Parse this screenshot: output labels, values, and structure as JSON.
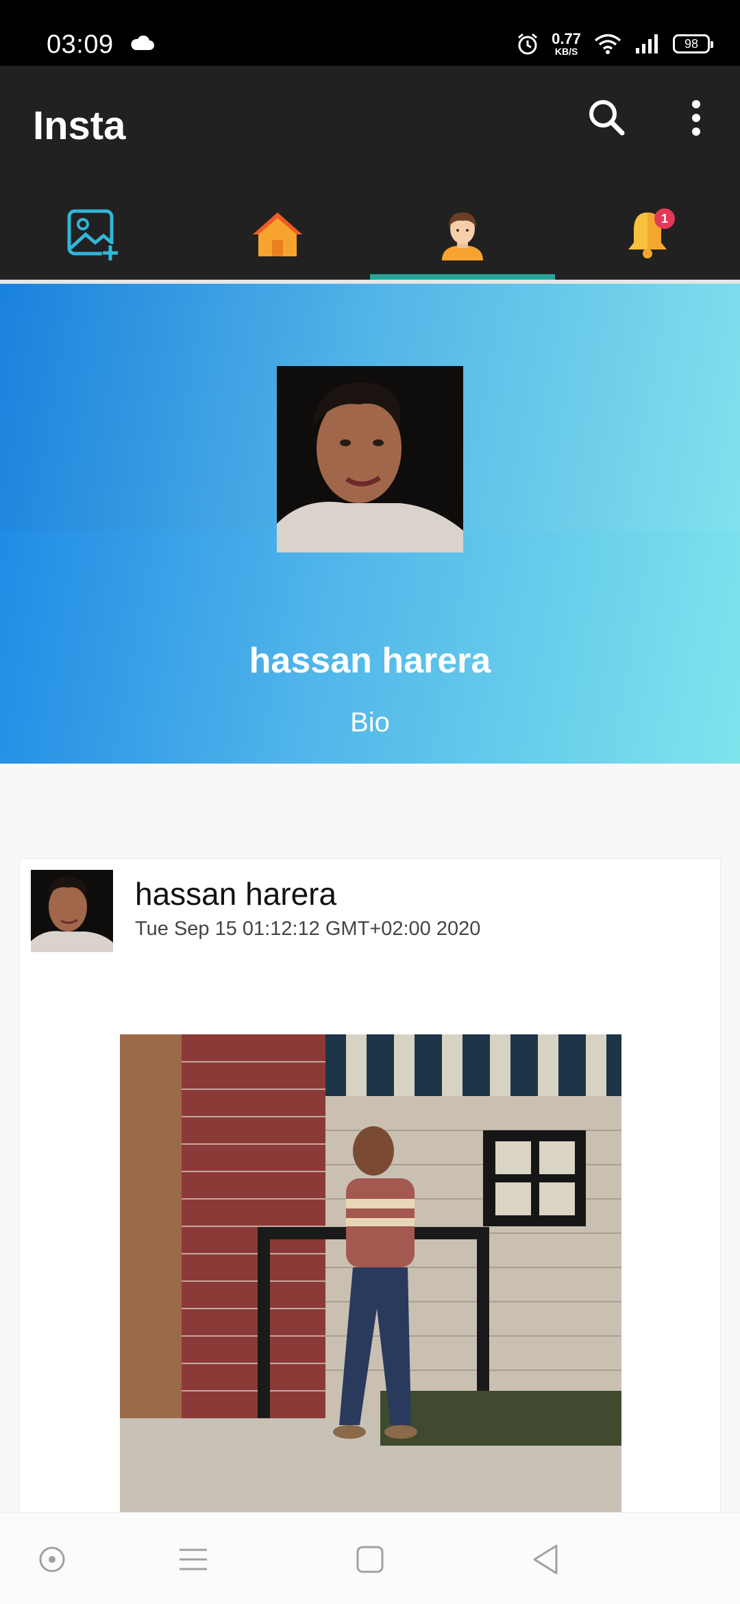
{
  "status_bar": {
    "time": "03:09",
    "speed_value": "0.77",
    "speed_unit": "KB/S",
    "battery": "98",
    "icons": [
      "cloud-icon",
      "alarm-icon",
      "wifi-icon",
      "signal-icon",
      "battery-icon"
    ]
  },
  "app_bar": {
    "title": "Insta",
    "actions": [
      "search-icon",
      "more-vert-icon"
    ]
  },
  "tabs": [
    {
      "icon": "add-image-icon"
    },
    {
      "icon": "home-icon"
    },
    {
      "icon": "profile-icon",
      "selected": true
    },
    {
      "icon": "bell-icon",
      "badge": "1"
    }
  ],
  "profile": {
    "name": "hassan harera",
    "bio": "Bio"
  },
  "post": {
    "author": "hassan harera",
    "date": "Tue Sep 15 01:12:12 GMT+02:00 2020"
  },
  "colors": {
    "app_bar": "#212121",
    "tab_indicator": "#26a69a",
    "gradient_start": "#1a86e4",
    "gradient_end": "#7fe4ec",
    "badge": "#e53958"
  },
  "nav_bar": [
    "circle-icon",
    "menu-icon",
    "square-icon",
    "back-icon"
  ]
}
